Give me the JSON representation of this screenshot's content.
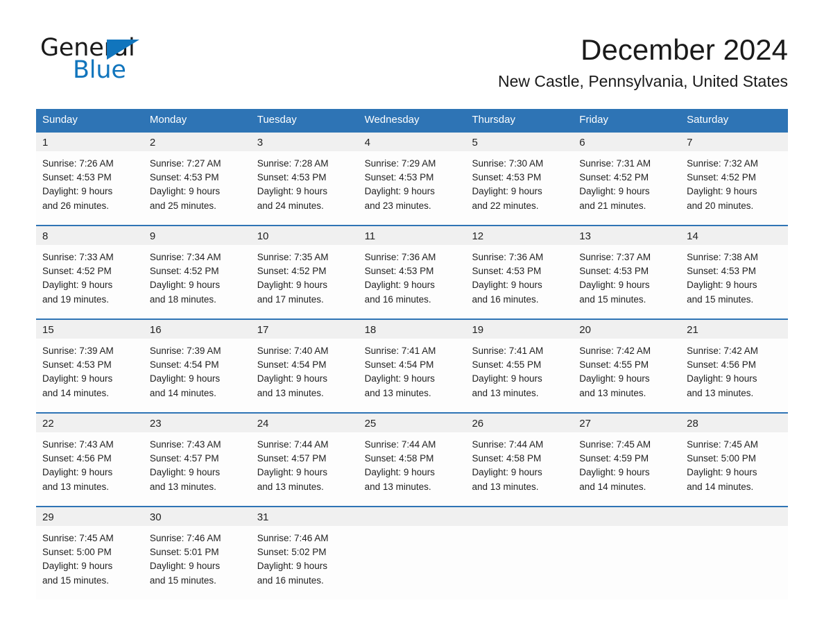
{
  "logo": {
    "word_one": "General",
    "word_two": "Blue",
    "triangle": "triangle-mark"
  },
  "header": {
    "month_title": "December 2024",
    "location": "New Castle, Pennsylvania, United States"
  },
  "colors": {
    "header_blue": "#2e74b5",
    "row_divider_blue": "#2e74b5",
    "daynum_band": "#f0f0f0",
    "logo_blue": "#1175bd",
    "text": "#1a1a1a"
  },
  "calendar": {
    "weekdays": [
      "Sunday",
      "Monday",
      "Tuesday",
      "Wednesday",
      "Thursday",
      "Friday",
      "Saturday"
    ],
    "weeks": [
      {
        "days": [
          {
            "num": "1",
            "sunrise": "Sunrise: 7:26 AM",
            "sunset": "Sunset: 4:53 PM",
            "daylight1": "Daylight: 9 hours",
            "daylight2": "and 26 minutes."
          },
          {
            "num": "2",
            "sunrise": "Sunrise: 7:27 AM",
            "sunset": "Sunset: 4:53 PM",
            "daylight1": "Daylight: 9 hours",
            "daylight2": "and 25 minutes."
          },
          {
            "num": "3",
            "sunrise": "Sunrise: 7:28 AM",
            "sunset": "Sunset: 4:53 PM",
            "daylight1": "Daylight: 9 hours",
            "daylight2": "and 24 minutes."
          },
          {
            "num": "4",
            "sunrise": "Sunrise: 7:29 AM",
            "sunset": "Sunset: 4:53 PM",
            "daylight1": "Daylight: 9 hours",
            "daylight2": "and 23 minutes."
          },
          {
            "num": "5",
            "sunrise": "Sunrise: 7:30 AM",
            "sunset": "Sunset: 4:53 PM",
            "daylight1": "Daylight: 9 hours",
            "daylight2": "and 22 minutes."
          },
          {
            "num": "6",
            "sunrise": "Sunrise: 7:31 AM",
            "sunset": "Sunset: 4:52 PM",
            "daylight1": "Daylight: 9 hours",
            "daylight2": "and 21 minutes."
          },
          {
            "num": "7",
            "sunrise": "Sunrise: 7:32 AM",
            "sunset": "Sunset: 4:52 PM",
            "daylight1": "Daylight: 9 hours",
            "daylight2": "and 20 minutes."
          }
        ]
      },
      {
        "days": [
          {
            "num": "8",
            "sunrise": "Sunrise: 7:33 AM",
            "sunset": "Sunset: 4:52 PM",
            "daylight1": "Daylight: 9 hours",
            "daylight2": "and 19 minutes."
          },
          {
            "num": "9",
            "sunrise": "Sunrise: 7:34 AM",
            "sunset": "Sunset: 4:52 PM",
            "daylight1": "Daylight: 9 hours",
            "daylight2": "and 18 minutes."
          },
          {
            "num": "10",
            "sunrise": "Sunrise: 7:35 AM",
            "sunset": "Sunset: 4:52 PM",
            "daylight1": "Daylight: 9 hours",
            "daylight2": "and 17 minutes."
          },
          {
            "num": "11",
            "sunrise": "Sunrise: 7:36 AM",
            "sunset": "Sunset: 4:53 PM",
            "daylight1": "Daylight: 9 hours",
            "daylight2": "and 16 minutes."
          },
          {
            "num": "12",
            "sunrise": "Sunrise: 7:36 AM",
            "sunset": "Sunset: 4:53 PM",
            "daylight1": "Daylight: 9 hours",
            "daylight2": "and 16 minutes."
          },
          {
            "num": "13",
            "sunrise": "Sunrise: 7:37 AM",
            "sunset": "Sunset: 4:53 PM",
            "daylight1": "Daylight: 9 hours",
            "daylight2": "and 15 minutes."
          },
          {
            "num": "14",
            "sunrise": "Sunrise: 7:38 AM",
            "sunset": "Sunset: 4:53 PM",
            "daylight1": "Daylight: 9 hours",
            "daylight2": "and 15 minutes."
          }
        ]
      },
      {
        "days": [
          {
            "num": "15",
            "sunrise": "Sunrise: 7:39 AM",
            "sunset": "Sunset: 4:53 PM",
            "daylight1": "Daylight: 9 hours",
            "daylight2": "and 14 minutes."
          },
          {
            "num": "16",
            "sunrise": "Sunrise: 7:39 AM",
            "sunset": "Sunset: 4:54 PM",
            "daylight1": "Daylight: 9 hours",
            "daylight2": "and 14 minutes."
          },
          {
            "num": "17",
            "sunrise": "Sunrise: 7:40 AM",
            "sunset": "Sunset: 4:54 PM",
            "daylight1": "Daylight: 9 hours",
            "daylight2": "and 13 minutes."
          },
          {
            "num": "18",
            "sunrise": "Sunrise: 7:41 AM",
            "sunset": "Sunset: 4:54 PM",
            "daylight1": "Daylight: 9 hours",
            "daylight2": "and 13 minutes."
          },
          {
            "num": "19",
            "sunrise": "Sunrise: 7:41 AM",
            "sunset": "Sunset: 4:55 PM",
            "daylight1": "Daylight: 9 hours",
            "daylight2": "and 13 minutes."
          },
          {
            "num": "20",
            "sunrise": "Sunrise: 7:42 AM",
            "sunset": "Sunset: 4:55 PM",
            "daylight1": "Daylight: 9 hours",
            "daylight2": "and 13 minutes."
          },
          {
            "num": "21",
            "sunrise": "Sunrise: 7:42 AM",
            "sunset": "Sunset: 4:56 PM",
            "daylight1": "Daylight: 9 hours",
            "daylight2": "and 13 minutes."
          }
        ]
      },
      {
        "days": [
          {
            "num": "22",
            "sunrise": "Sunrise: 7:43 AM",
            "sunset": "Sunset: 4:56 PM",
            "daylight1": "Daylight: 9 hours",
            "daylight2": "and 13 minutes."
          },
          {
            "num": "23",
            "sunrise": "Sunrise: 7:43 AM",
            "sunset": "Sunset: 4:57 PM",
            "daylight1": "Daylight: 9 hours",
            "daylight2": "and 13 minutes."
          },
          {
            "num": "24",
            "sunrise": "Sunrise: 7:44 AM",
            "sunset": "Sunset: 4:57 PM",
            "daylight1": "Daylight: 9 hours",
            "daylight2": "and 13 minutes."
          },
          {
            "num": "25",
            "sunrise": "Sunrise: 7:44 AM",
            "sunset": "Sunset: 4:58 PM",
            "daylight1": "Daylight: 9 hours",
            "daylight2": "and 13 minutes."
          },
          {
            "num": "26",
            "sunrise": "Sunrise: 7:44 AM",
            "sunset": "Sunset: 4:58 PM",
            "daylight1": "Daylight: 9 hours",
            "daylight2": "and 13 minutes."
          },
          {
            "num": "27",
            "sunrise": "Sunrise: 7:45 AM",
            "sunset": "Sunset: 4:59 PM",
            "daylight1": "Daylight: 9 hours",
            "daylight2": "and 14 minutes."
          },
          {
            "num": "28",
            "sunrise": "Sunrise: 7:45 AM",
            "sunset": "Sunset: 5:00 PM",
            "daylight1": "Daylight: 9 hours",
            "daylight2": "and 14 minutes."
          }
        ]
      },
      {
        "days": [
          {
            "num": "29",
            "sunrise": "Sunrise: 7:45 AM",
            "sunset": "Sunset: 5:00 PM",
            "daylight1": "Daylight: 9 hours",
            "daylight2": "and 15 minutes."
          },
          {
            "num": "30",
            "sunrise": "Sunrise: 7:46 AM",
            "sunset": "Sunset: 5:01 PM",
            "daylight1": "Daylight: 9 hours",
            "daylight2": "and 15 minutes."
          },
          {
            "num": "31",
            "sunrise": "Sunrise: 7:46 AM",
            "sunset": "Sunset: 5:02 PM",
            "daylight1": "Daylight: 9 hours",
            "daylight2": "and 16 minutes."
          },
          {
            "num": "",
            "sunrise": "",
            "sunset": "",
            "daylight1": "",
            "daylight2": ""
          },
          {
            "num": "",
            "sunrise": "",
            "sunset": "",
            "daylight1": "",
            "daylight2": ""
          },
          {
            "num": "",
            "sunrise": "",
            "sunset": "",
            "daylight1": "",
            "daylight2": ""
          },
          {
            "num": "",
            "sunrise": "",
            "sunset": "",
            "daylight1": "",
            "daylight2": ""
          }
        ]
      }
    ]
  }
}
